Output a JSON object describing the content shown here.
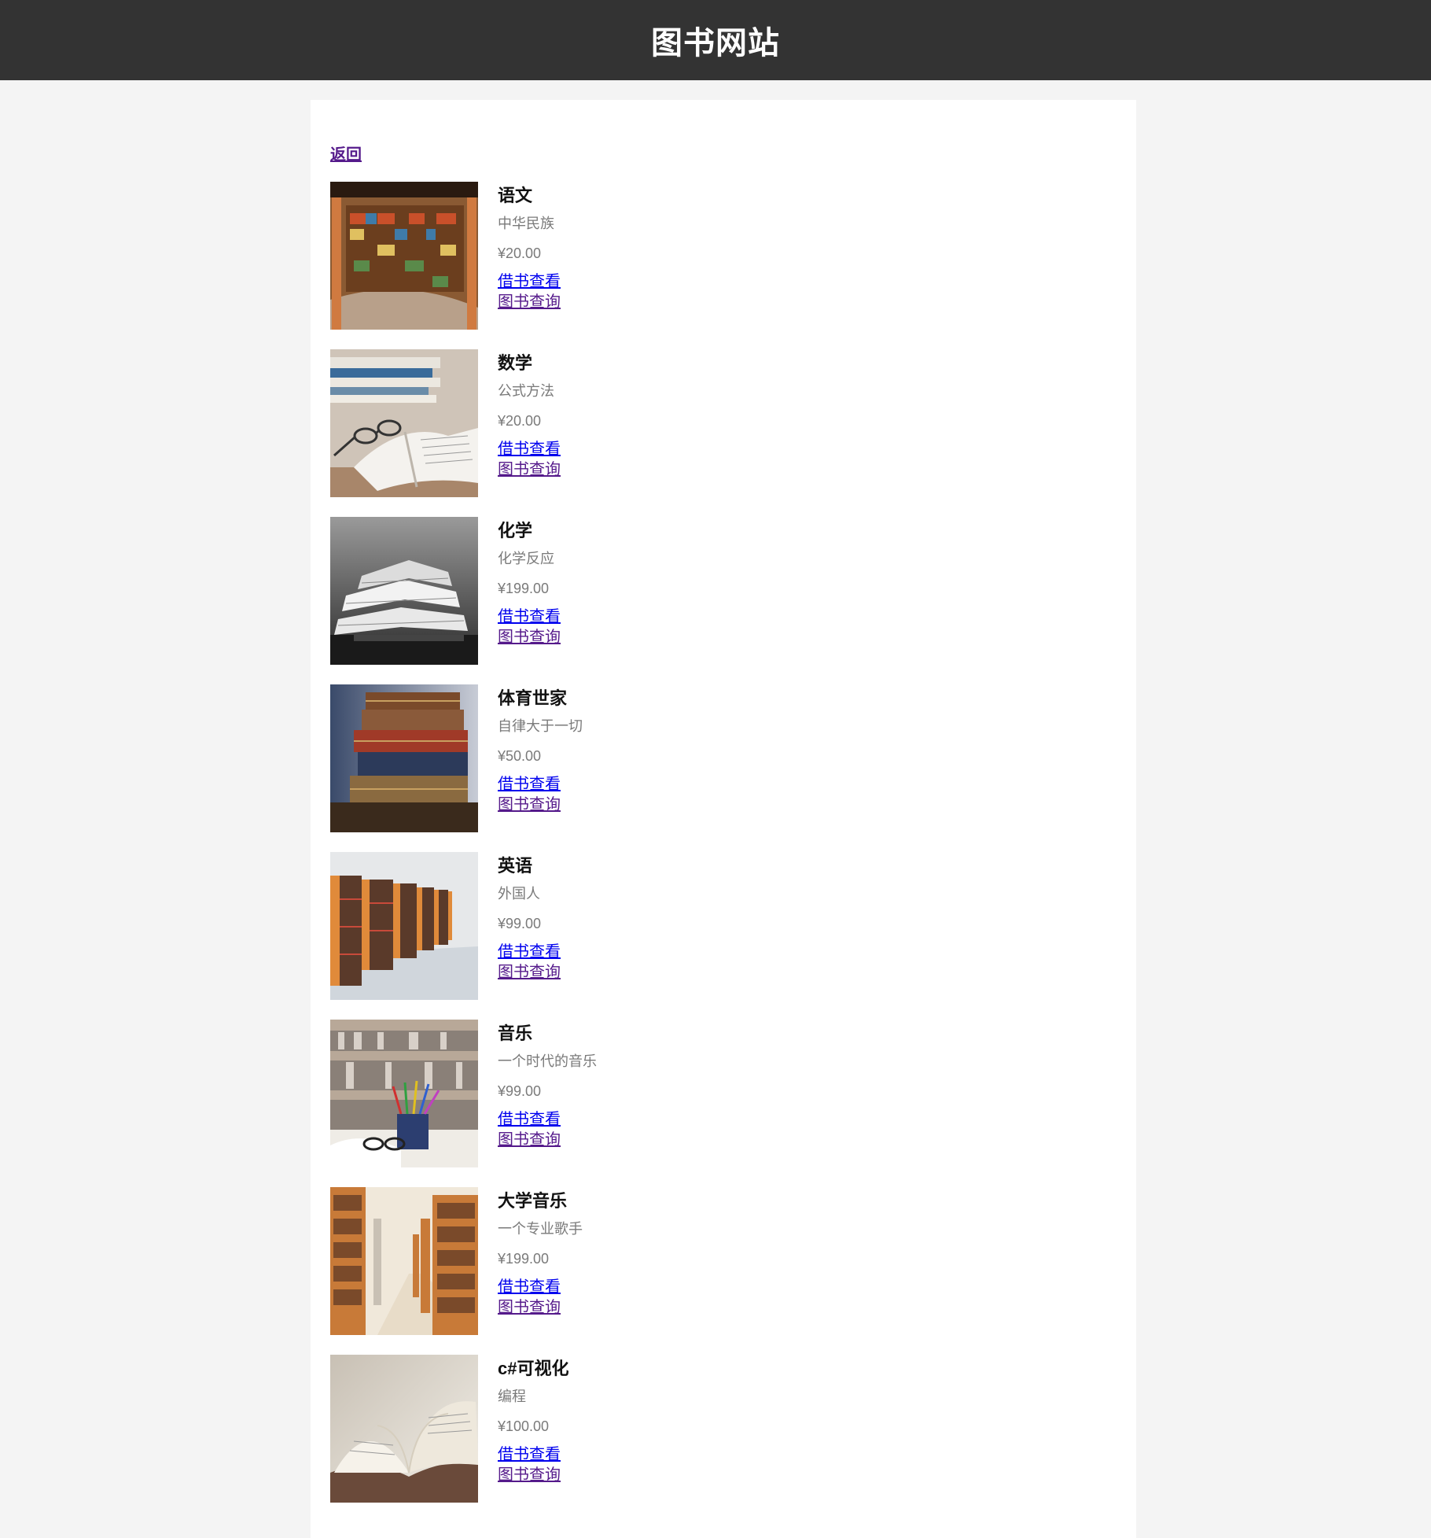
{
  "header": {
    "title": "图书网站"
  },
  "nav": {
    "back_label": "返回"
  },
  "books": [
    {
      "title": "语文",
      "description": "中华民族",
      "price": "¥20.00",
      "borrow_label": "借书查看",
      "query_label": "图书查询",
      "cover": "library-curved-shelves"
    },
    {
      "title": "数学",
      "description": "公式方法",
      "price": "¥20.00",
      "borrow_label": "借书查看",
      "query_label": "图书查询",
      "cover": "open-book-with-glasses"
    },
    {
      "title": "化学",
      "description": "化学反应",
      "price": "¥199.00",
      "borrow_label": "借书查看",
      "query_label": "图书查询",
      "cover": "stacked-open-books-bw"
    },
    {
      "title": "体育世家",
      "description": "自律大于一切",
      "price": "¥50.00",
      "borrow_label": "借书查看",
      "query_label": "图书查询",
      "cover": "antique-book-stack"
    },
    {
      "title": "英语",
      "description": "外国人",
      "price": "¥99.00",
      "borrow_label": "借书查看",
      "query_label": "图书查询",
      "cover": "library-aisle-shelves"
    },
    {
      "title": "音乐",
      "description": "一个时代的音乐",
      "price": "¥99.00",
      "borrow_label": "借书查看",
      "query_label": "图书查询",
      "cover": "pencils-and-glasses-library"
    },
    {
      "title": "大学音乐",
      "description": "一个专业歌手",
      "price": "¥199.00",
      "borrow_label": "借书查看",
      "query_label": "图书查询",
      "cover": "library-corridor"
    },
    {
      "title": "c#可视化",
      "description": "编程",
      "price": "¥100.00",
      "borrow_label": "借书查看",
      "query_label": "图书查询",
      "cover": "open-book-pages"
    }
  ],
  "colors": {
    "header_bg": "#333333",
    "page_bg": "#f4f4f4",
    "link": "#0000ee",
    "visited_link": "#551a8b",
    "muted_text": "#7a7a7a"
  }
}
